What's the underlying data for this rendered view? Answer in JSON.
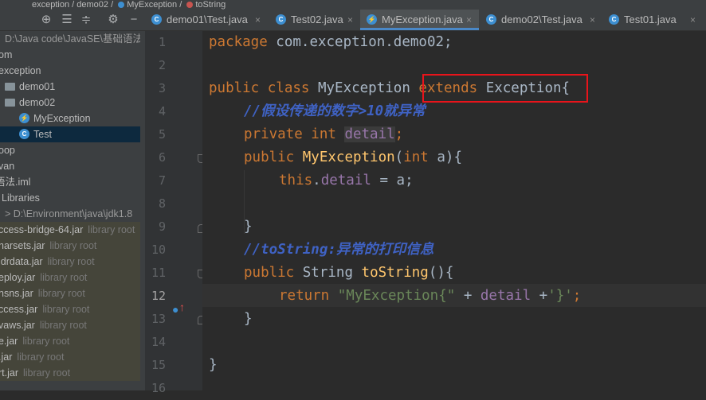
{
  "breadcrumb": [
    "exception",
    "demo02",
    "MyException",
    "toString"
  ],
  "sidebar": {
    "toolbar_icons": [
      "crosshair-icon",
      "expand-all-icon",
      "collapse-all-icon",
      "gear-icon",
      "minimize-icon"
    ],
    "path": "D:\\Java code\\JavaSE\\基础语法",
    "items": [
      {
        "label": "om",
        "sub": ""
      },
      {
        "label": "exception",
        "sub": ""
      },
      {
        "label": "demo01",
        "sub": ""
      },
      {
        "label": "demo02",
        "sub": ""
      },
      {
        "label": "MyException",
        "sub": ""
      },
      {
        "label": "Test",
        "sub": ""
      },
      {
        "label": "oop",
        "sub": ""
      },
      {
        "label": "van",
        "sub": ""
      },
      {
        "label": "语法.iml",
        "sub": ""
      },
      {
        "label": "Libraries",
        "sub": ""
      },
      {
        "label": "> D:\\Environment\\java\\jdk1.8",
        "sub": ""
      }
    ],
    "libraries": [
      {
        "label": "ccess-bridge-64.jar",
        "sub": "library root"
      },
      {
        "label": "harsets.jar",
        "sub": "library root"
      },
      {
        "label": "ldrdata.jar",
        "sub": "library root"
      },
      {
        "label": "eploy.jar",
        "sub": "library root"
      },
      {
        "label": "nsns.jar",
        "sub": "library root"
      },
      {
        "label": "ccess.jar",
        "sub": "library root"
      },
      {
        "label": "vaws.jar",
        "sub": "library root"
      },
      {
        "label": "e.jar",
        "sub": "library root"
      },
      {
        "label": ".jar",
        "sub": "library root"
      },
      {
        "label": "rt.jar",
        "sub": "library root"
      }
    ]
  },
  "tabs": [
    {
      "label": "demo01\\Test.java",
      "active": false
    },
    {
      "label": "Test02.java",
      "active": false
    },
    {
      "label": "MyException.java",
      "active": true
    },
    {
      "label": "demo02\\Test.java",
      "active": false
    },
    {
      "label": "Test01.java",
      "active": false
    }
  ],
  "tab_close": "×",
  "line_numbers": [
    "1",
    "2",
    "3",
    "4",
    "5",
    "6",
    "7",
    "8",
    "9",
    "10",
    "11",
    "12",
    "13",
    "14",
    "15",
    "16"
  ],
  "code": {
    "l1_kw": "package ",
    "l1_rest": "com.exception.demo02;",
    "l3_kw": "public class ",
    "l3_name": "MyException ",
    "l3_ext": "extends ",
    "l3_rest": "Exception{",
    "l4_cmt": "//假设传递的数字>10就异常",
    "l5_kw": "private int ",
    "l5_fld": "detail",
    "l5_end": ";",
    "l6_kw": "public ",
    "l6_fn": "MyException",
    "l6_p": "(",
    "l6_kw2": "int ",
    "l6_rest": "a){",
    "l7_kw": "this",
    "l7_dot": ".",
    "l7_fld": "detail",
    "l7_rest": " = a;",
    "l9": "}",
    "l10_cmt": "//toString:异常的打印信息",
    "l11_kw": "public ",
    "l11_type": "String ",
    "l11_fn": "toString",
    "l11_rest": "(){",
    "l12_kw": "return ",
    "l12_str": "\"MyException{\"",
    "l12_plus": " + ",
    "l12_fld": "detail",
    "l12_plus2": " +",
    "l12_str2": "'}'",
    "l12_end": ";",
    "l13": "}",
    "l15": "}"
  }
}
